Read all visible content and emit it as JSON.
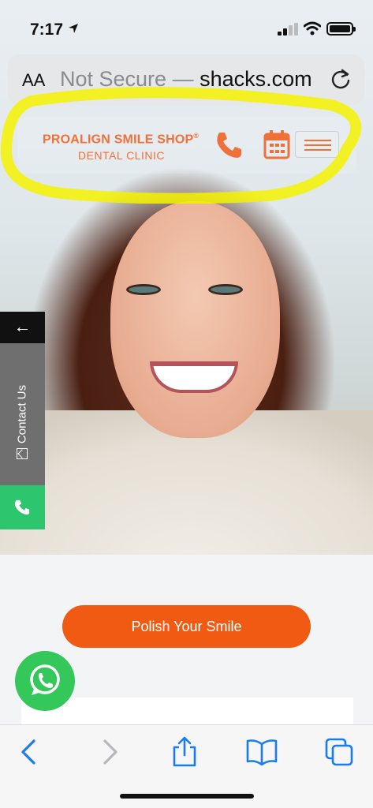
{
  "status_bar": {
    "time": "7:17"
  },
  "address_bar": {
    "text_size_label": "AA",
    "url_prefix": "Not Secure — ",
    "url_host": "shacks.com"
  },
  "site_header": {
    "brand_line1": "PROALIGN SMILE SHOP",
    "brand_mark": "®",
    "brand_line2": "DENTAL CLINIC"
  },
  "contact_tab": {
    "arrow": "←",
    "label": "Contact Us"
  },
  "cta": {
    "label": "Polish Your Smile"
  },
  "colors": {
    "brand_orange": "#f0703a",
    "cta_orange": "#f05a12",
    "whatsapp_green": "#34c759",
    "call_green": "#2dc56e",
    "ios_blue": "#1a7cf0",
    "highlight_yellow": "#f4f200"
  },
  "icons": [
    "location-arrow-icon",
    "signal-icon",
    "wifi-icon",
    "battery-icon",
    "reload-icon",
    "phone-icon",
    "calendar-icon",
    "menu-icon",
    "mail-icon",
    "whatsapp-icon",
    "back-icon",
    "forward-icon",
    "share-icon",
    "bookmarks-icon",
    "tabs-icon"
  ]
}
